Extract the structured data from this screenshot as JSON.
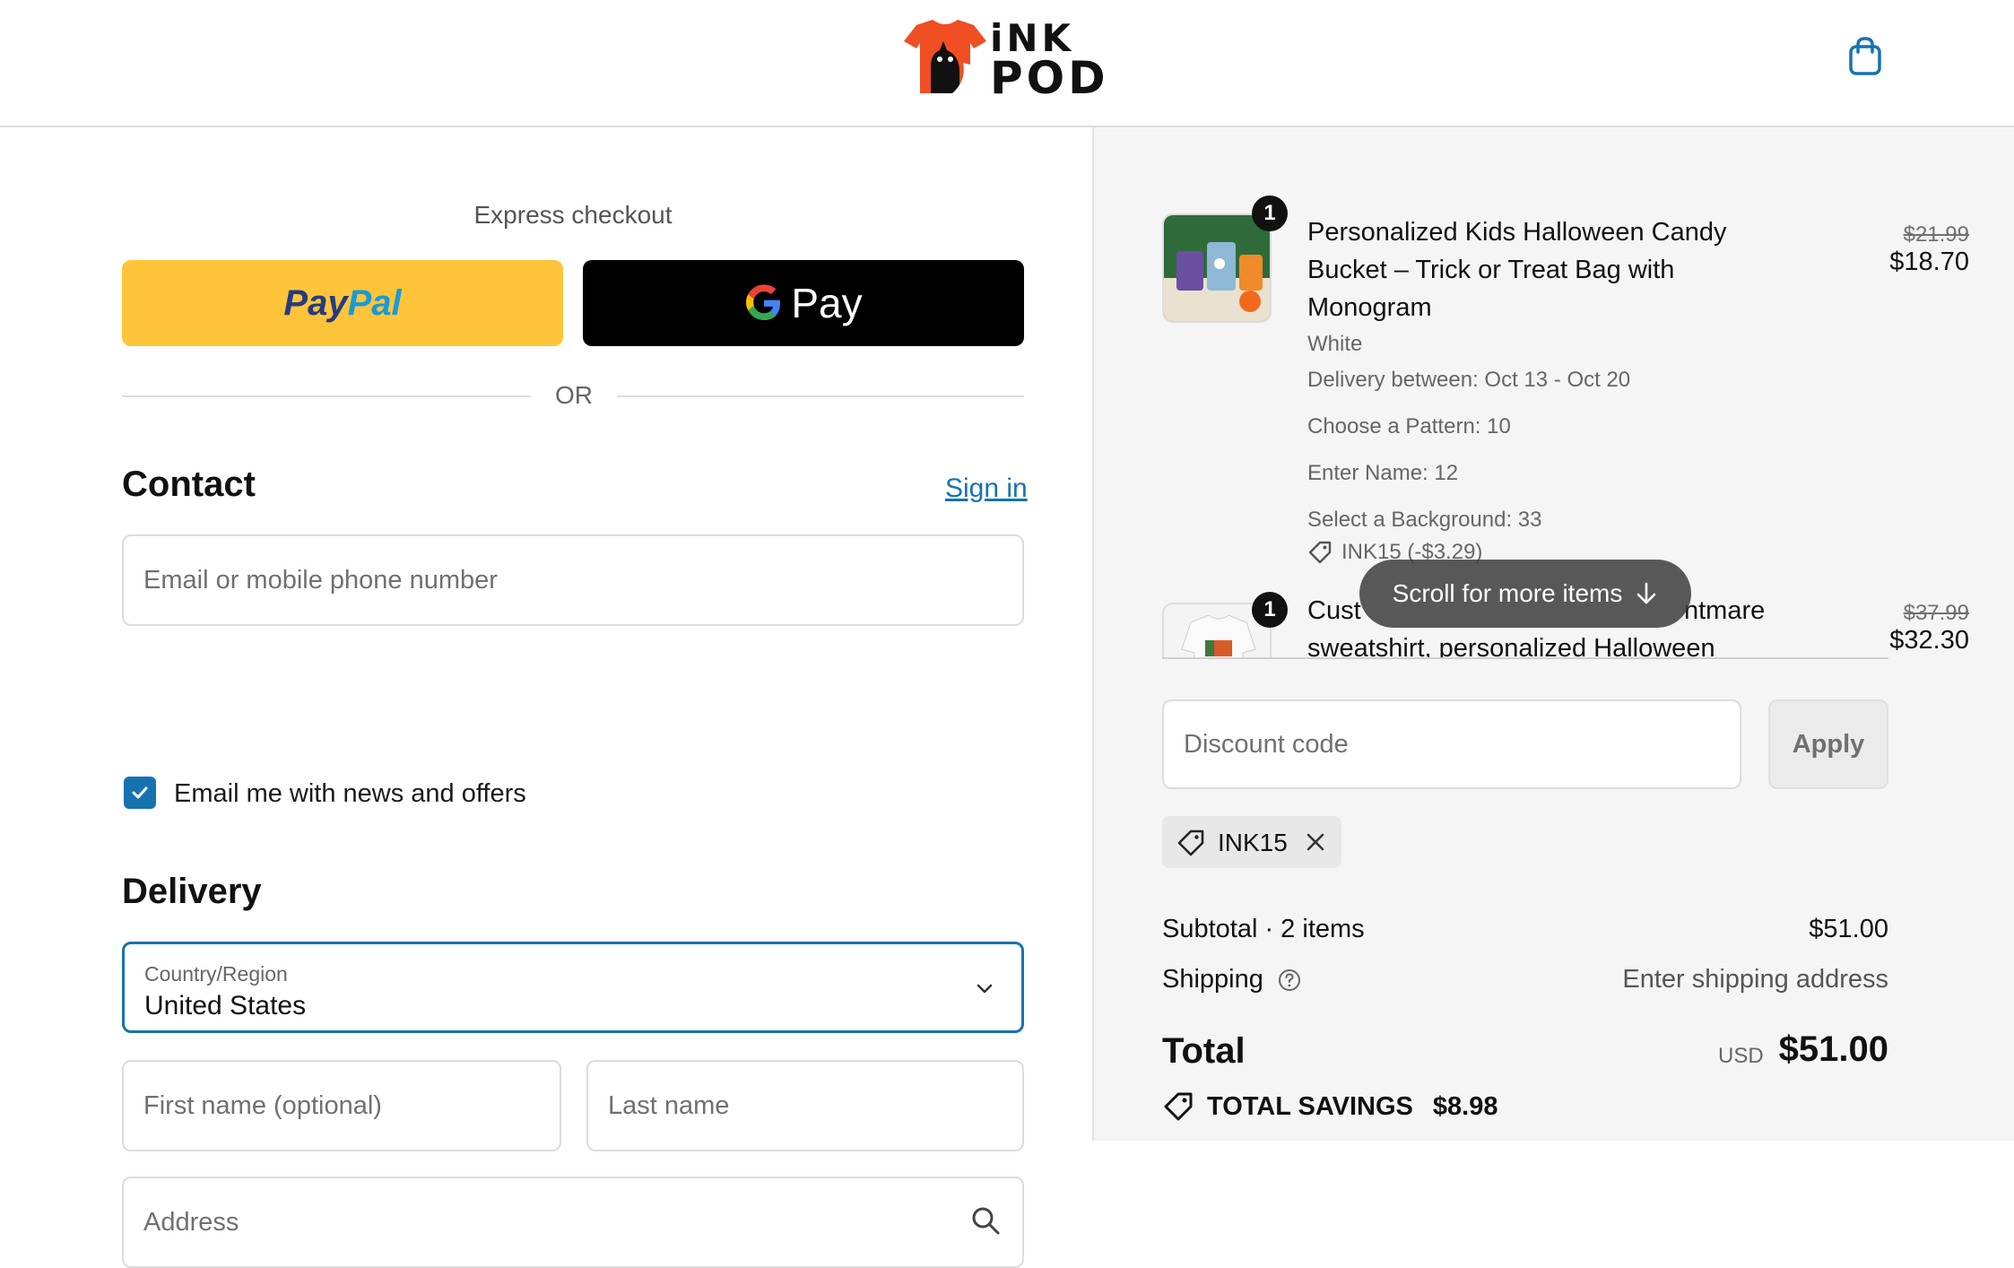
{
  "header": {
    "logo_line1": "iNK",
    "logo_line2": "POD",
    "cart_icon": "shopping-bag-icon"
  },
  "express": {
    "title": "Express checkout",
    "paypal_label_part1": "Pay",
    "paypal_label_part2": "Pal",
    "gpay_label": "Pay",
    "divider_text": "OR"
  },
  "contact": {
    "heading": "Contact",
    "signin_label": "Sign in",
    "email_placeholder": "Email or mobile phone number",
    "newsletter_label": "Email me with news and offers",
    "newsletter_checked": true
  },
  "delivery": {
    "heading": "Delivery",
    "country_label": "Country/Region",
    "country_value": "United States",
    "first_name_placeholder": "First name (optional)",
    "last_name_placeholder": "Last name",
    "address_placeholder": "Address"
  },
  "order": {
    "items": [
      {
        "qty": "1",
        "title": "Personalized Kids Halloween Candy Bucket – Trick or Treat Bag with Monogram",
        "old_price": "$21.99",
        "price": "$18.70",
        "variant": "White",
        "delivery": "Delivery between: Oct 13 - Oct 20",
        "options": [
          "Choose a Pattern: 10",
          "Enter Name: 12",
          "Select a Background: 33"
        ],
        "discount": "INK15 (-$3.29)"
      },
      {
        "qty": "1",
        "title_start": "Cust",
        "title_end": "ntmare",
        "title_line2": "sweatshirt, personalized Halloween",
        "old_price": "$37.99",
        "price": "$32.30"
      }
    ],
    "scroll_hint": "Scroll for more items",
    "discount_placeholder": "Discount code",
    "apply_label": "Apply",
    "applied_code": "INK15",
    "subtotal_label": "Subtotal · 2 items",
    "subtotal_value": "$51.00",
    "shipping_label": "Shipping",
    "shipping_value": "Enter shipping address",
    "total_label": "Total",
    "total_currency": "USD",
    "total_value": "$51.00",
    "savings_label": "TOTAL SAVINGS",
    "savings_value": "$8.98"
  },
  "colors": {
    "paypal_yellow": "#ffc439",
    "paypal_dark_blue": "#253b80",
    "paypal_light_blue": "#179bd7",
    "link_blue": "#1773b0",
    "logo_orange": "#f04e23"
  }
}
